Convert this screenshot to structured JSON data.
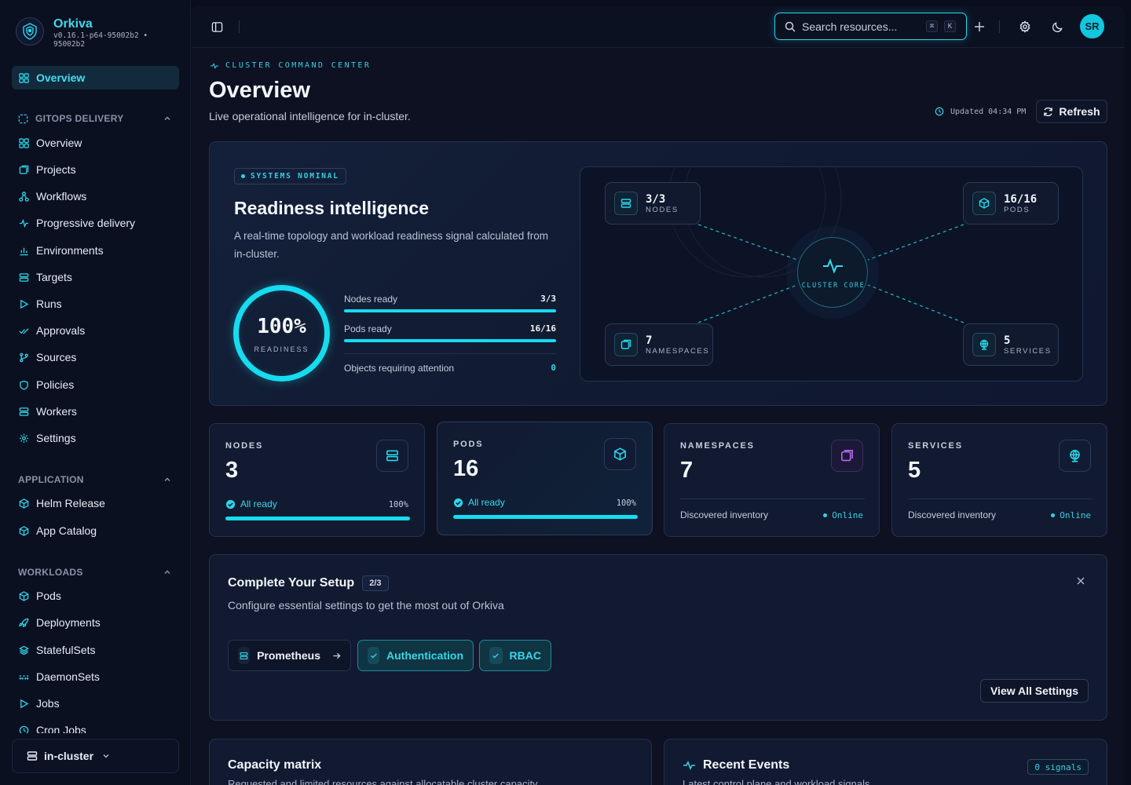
{
  "brand": {
    "name": "Orkiva",
    "version": "v0.16.1-p64-95002b2 • 95002b2"
  },
  "sidebar": {
    "top_item": "Overview",
    "sections": [
      {
        "title": "GITOPS DELIVERY",
        "items": [
          "Overview",
          "Projects",
          "Workflows",
          "Progressive delivery",
          "Environments",
          "Targets",
          "Runs",
          "Approvals",
          "Sources",
          "Policies",
          "Workers",
          "Settings"
        ]
      },
      {
        "title": "APPLICATION",
        "items": [
          "Helm Release",
          "App Catalog"
        ]
      },
      {
        "title": "WORKLOADS",
        "items": [
          "Pods",
          "Deployments",
          "StatefulSets",
          "DaemonSets",
          "Jobs",
          "Cron Jobs"
        ]
      }
    ],
    "cluster": "in-cluster"
  },
  "topbar": {
    "search_placeholder": "Search resources...",
    "kbd": [
      "⌘",
      "K"
    ],
    "avatar": "SR"
  },
  "header": {
    "eyebrow": "CLUSTER COMMAND CENTER",
    "title": "Overview",
    "subtitle": "Live operational intelligence for in-cluster.",
    "updated": "Updated 04:34 PM",
    "refresh": "Refresh"
  },
  "hero": {
    "badge": "SYSTEMS NOMINAL",
    "title": "Readiness intelligence",
    "description": "A real-time topology and workload readiness signal calculated from in-cluster.",
    "readiness_value": "100%",
    "readiness_label": "READINESS",
    "metrics": [
      {
        "label": "Nodes ready",
        "value": "3/3",
        "progress": 1.0
      },
      {
        "label": "Pods ready",
        "value": "16/16",
        "progress": 1.0
      },
      {
        "label": "Objects requiring attention",
        "value": "0"
      }
    ],
    "topology": {
      "core": "CLUSTER CORE",
      "nodes": [
        {
          "value": "3/3",
          "label": "NODES",
          "icon": "server-icon"
        },
        {
          "value": "16/16",
          "label": "PODS",
          "icon": "cube-icon"
        },
        {
          "value": "7",
          "label": "NAMESPACES",
          "icon": "layers-icon"
        },
        {
          "value": "5",
          "label": "SERVICES",
          "icon": "globe-icon"
        }
      ]
    }
  },
  "stats": [
    {
      "label": "NODES",
      "value": "3",
      "status": "All ready",
      "percent": "100%",
      "progress": 1.0,
      "icon": "server-icon"
    },
    {
      "label": "PODS",
      "value": "16",
      "status": "All ready",
      "percent": "100%",
      "progress": 1.0,
      "icon": "cube-icon"
    },
    {
      "label": "NAMESPACES",
      "value": "7",
      "footer": "Discovered inventory",
      "state": "Online",
      "icon": "layers-icon"
    },
    {
      "label": "SERVICES",
      "value": "5",
      "footer": "Discovered inventory",
      "state": "Online",
      "icon": "globe-icon"
    }
  ],
  "setup": {
    "title": "Complete Your Setup",
    "progress": "2/3",
    "subtitle": "Configure essential settings to get the most out of Orkiva",
    "steps": [
      {
        "label": "Prometheus",
        "done": false
      },
      {
        "label": "Authentication",
        "done": true
      },
      {
        "label": "RBAC",
        "done": true
      }
    ],
    "view_all": "View All Settings"
  },
  "capacity": {
    "title": "Capacity matrix",
    "subtitle": "Requested and limited resources against allocatable cluster capacity"
  },
  "events": {
    "title": "Recent Events",
    "subtitle": "Latest control plane and workload signals",
    "badge": "0 signals"
  },
  "colors": {
    "accent": "#16dcef",
    "background": "#0a0e1c",
    "namespace_accent": "#b46cf2"
  }
}
